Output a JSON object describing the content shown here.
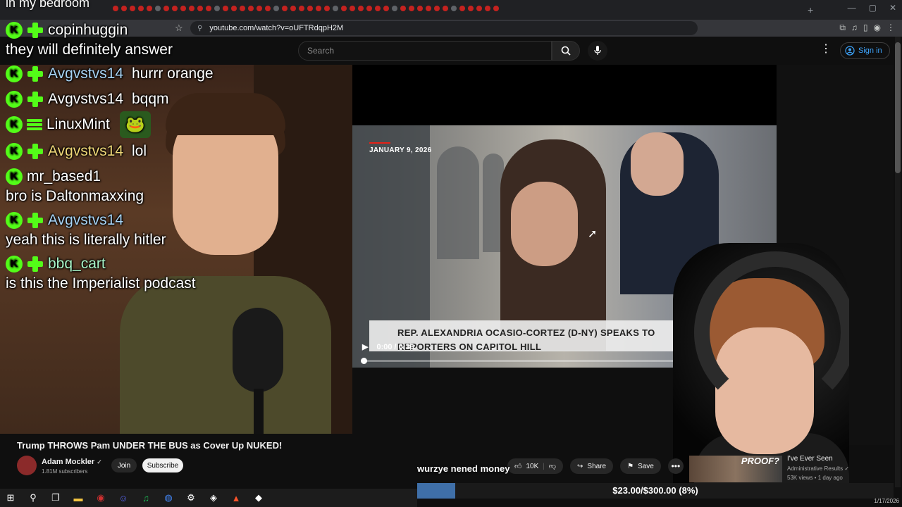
{
  "browser": {
    "url": "youtube.com/watch?v=oUFTRdqpH2M",
    "new_tab": "+",
    "minimize": "—",
    "maximize": "▢",
    "close": "✕"
  },
  "yt_header": {
    "search_placeholder": "Search",
    "signin_label": "Sign in"
  },
  "stream_title_top": "in my bedroom",
  "chat": [
    {
      "user": "copinhuggin",
      "message": "they will definitely answer",
      "badges": [
        "kick",
        "plus"
      ],
      "user_color": "#ffffff",
      "wrap": true
    },
    {
      "user": "Avgvstvs14",
      "message": "hurrr orange",
      "badges": [
        "kick",
        "plus"
      ],
      "user_color": "#a8d4f5",
      "wrap": false
    },
    {
      "user": "Avgvstvs14",
      "message": "bqqm",
      "badges": [
        "kick",
        "plus"
      ],
      "user_color": "#ffffff",
      "wrap": false
    },
    {
      "user": "LinuxMint",
      "message": "",
      "badges": [
        "kick",
        "bar"
      ],
      "user_color": "#ffffff",
      "wrap": false,
      "emote": "🐸"
    },
    {
      "user": "Avgvstvs14",
      "message": "lol",
      "badges": [
        "kick",
        "plus"
      ],
      "user_color": "#f0d878",
      "wrap": false
    },
    {
      "user": "mr_based1",
      "message": "bro is Daltonmaxxing",
      "badges": [
        "kick"
      ],
      "user_color": "#ffffff",
      "wrap": true
    },
    {
      "user": "Avgvstvs14",
      "message": "yeah this is literally hitler",
      "badges": [
        "kick",
        "plus"
      ],
      "user_color": "#a8d4f5",
      "wrap": true
    },
    {
      "user": "bbq_cart",
      "message": "is this the Imperialist podcast",
      "badges": [
        "kick",
        "plus"
      ],
      "user_color": "#a8f5c8",
      "wrap": true
    }
  ],
  "player": {
    "date_tag": "JANUARY 9, 2026",
    "lower_third": "REP. ALEXANDRIA OCASIO-CORTEZ (D-NY) SPEAKS TO REPORTERS ON CAPITOL HILL",
    "time": "0:00 / 0:36",
    "progress": 0
  },
  "video": {
    "title": "Trump THROWS Pam UNDER THE BUS as Cover Up NUKED!",
    "channel": "Adam Mockler",
    "subscribers": "1.81M subscribers",
    "join_label": "Join",
    "subscribe_label": "Subscribe",
    "likes": "10K",
    "share_label": "Share",
    "save_label": "Save",
    "more": "•••"
  },
  "overlay_text": "wurzye nened money",
  "recommended": {
    "thumb_text": "PROOF?",
    "title": "I've Ever Seen",
    "channel": "Administrative Results",
    "meta": "53K views • 1 day ago"
  },
  "goal": {
    "text": "$23.00/$300.00 (8%)",
    "fraction": 0.08,
    "color": "#3f6fa8"
  },
  "taskbar": {
    "icons": [
      "windows-icon",
      "search-icon",
      "task-view-icon",
      "file-explorer-icon",
      "obs-icon",
      "discord-icon",
      "spotify-icon",
      "chrome-icon",
      "steam-icon",
      "app-icon",
      "brave-icon",
      "app2-icon"
    ],
    "clock": "1/17/2026"
  },
  "colors": {
    "kick_green": "#53fc18",
    "yt_background": "#0f0f0f",
    "link_blue": "#3ea6ff"
  }
}
